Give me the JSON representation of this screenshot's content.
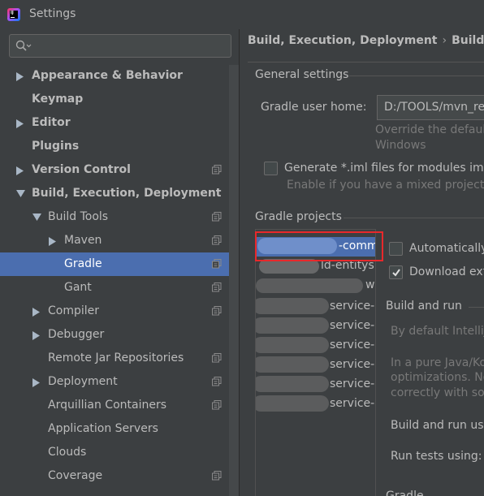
{
  "window": {
    "title": "Settings"
  },
  "search": {
    "placeholder": ""
  },
  "tree": [
    {
      "label": "Appearance & Behavior",
      "level": 0,
      "arrow": "right",
      "bold": true,
      "project": false,
      "selected": false,
      "name": "tree-item-appearance-behavior"
    },
    {
      "label": "Keymap",
      "level": 0,
      "arrow": "none",
      "bold": true,
      "project": false,
      "selected": false,
      "name": "tree-item-keymap"
    },
    {
      "label": "Editor",
      "level": 0,
      "arrow": "right",
      "bold": true,
      "project": false,
      "selected": false,
      "name": "tree-item-editor"
    },
    {
      "label": "Plugins",
      "level": 0,
      "arrow": "none",
      "bold": true,
      "project": false,
      "selected": false,
      "name": "tree-item-plugins"
    },
    {
      "label": "Version Control",
      "level": 0,
      "arrow": "right",
      "bold": true,
      "project": true,
      "selected": false,
      "name": "tree-item-version-control"
    },
    {
      "label": "Build, Execution, Deployment",
      "level": 0,
      "arrow": "down",
      "bold": true,
      "project": false,
      "selected": false,
      "name": "tree-item-build-execution-deployment"
    },
    {
      "label": "Build Tools",
      "level": 1,
      "arrow": "down",
      "bold": false,
      "project": true,
      "selected": false,
      "name": "tree-item-build-tools"
    },
    {
      "label": "Maven",
      "level": 2,
      "arrow": "right",
      "bold": false,
      "project": true,
      "selected": false,
      "name": "tree-item-maven"
    },
    {
      "label": "Gradle",
      "level": 2,
      "arrow": "none",
      "bold": false,
      "project": true,
      "selected": true,
      "name": "tree-item-gradle"
    },
    {
      "label": "Gant",
      "level": 2,
      "arrow": "none",
      "bold": false,
      "project": true,
      "selected": false,
      "name": "tree-item-gant"
    },
    {
      "label": "Compiler",
      "level": 1,
      "arrow": "right",
      "bold": false,
      "project": true,
      "selected": false,
      "name": "tree-item-compiler"
    },
    {
      "label": "Debugger",
      "level": 1,
      "arrow": "right",
      "bold": false,
      "project": false,
      "selected": false,
      "name": "tree-item-debugger"
    },
    {
      "label": "Remote Jar Repositories",
      "level": 1,
      "arrow": "none",
      "bold": false,
      "project": true,
      "selected": false,
      "name": "tree-item-remote-jar-repositories"
    },
    {
      "label": "Deployment",
      "level": 1,
      "arrow": "right",
      "bold": false,
      "project": true,
      "selected": false,
      "name": "tree-item-deployment"
    },
    {
      "label": "Arquillian Containers",
      "level": 1,
      "arrow": "none",
      "bold": false,
      "project": true,
      "selected": false,
      "name": "tree-item-arquillian-containers"
    },
    {
      "label": "Application Servers",
      "level": 1,
      "arrow": "none",
      "bold": false,
      "project": false,
      "selected": false,
      "name": "tree-item-application-servers"
    },
    {
      "label": "Clouds",
      "level": 1,
      "arrow": "none",
      "bold": false,
      "project": false,
      "selected": false,
      "name": "tree-item-clouds"
    },
    {
      "label": "Coverage",
      "level": 1,
      "arrow": "none",
      "bold": false,
      "project": true,
      "selected": false,
      "name": "tree-item-coverage"
    }
  ],
  "breadcrumb": {
    "parent": "Build, Execution, Deployment",
    "separator": "›",
    "current": "Build Too"
  },
  "general": {
    "heading": "General settings",
    "gradle_home_label": "Gradle user home:",
    "gradle_home_value": "D:/TOOLS/mvn_rep",
    "override_hint_1": "Override the default",
    "override_hint_2": "Windows",
    "generate_iml_label": "Generate *.iml files for modules impo",
    "generate_iml_checked": false,
    "generate_iml_hint": "Enable if you have a mixed project w"
  },
  "projects": {
    "heading": "Gradle projects",
    "items": [
      "-commo",
      "ld-entitys",
      "w",
      "service-",
      "service-",
      "service-",
      "service-",
      "service-",
      "service-"
    ],
    "auto_import_label": "Automatically",
    "auto_import_checked": false,
    "download_label": "Download ext",
    "download_checked": true,
    "build_run_heading": "Build and run",
    "build_run_hint_1": "By default IntelliJ",
    "build_run_hint_2": "In a pure Java/Ko",
    "build_run_hint_3": "optimizations. No",
    "build_run_hint_4": "correctly with son",
    "build_run_using_label": "Build and run usi",
    "run_tests_label": "Run tests using:",
    "next_heading": "Gradle"
  },
  "colors": {
    "selection": "#4b6eaf",
    "highlight_box": "#e8282b",
    "background": "#3c3f41"
  }
}
